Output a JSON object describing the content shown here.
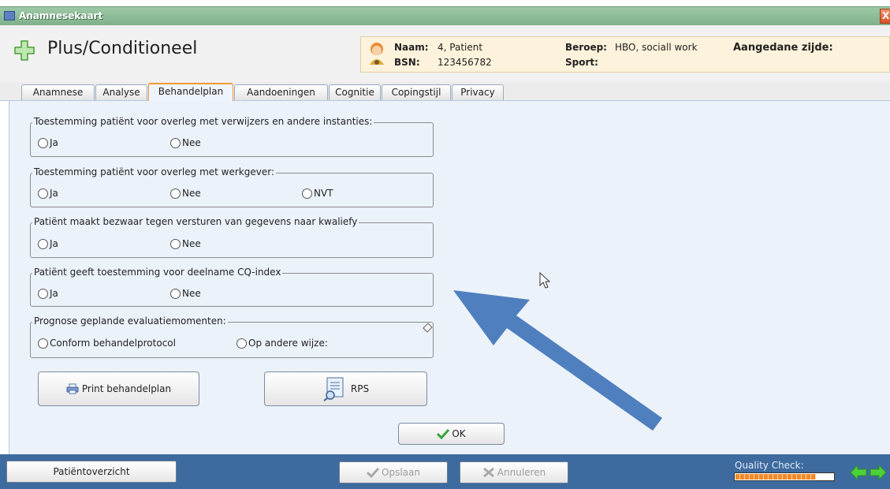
{
  "window": {
    "title": "Anamnesekaart",
    "close_glyph": "X"
  },
  "app": {
    "name": "Plus/Conditioneel",
    "icon": "plus-icon"
  },
  "patient": {
    "naam_label": "Naam:",
    "naam_value": "4, Patient",
    "bsn_label": "BSN:",
    "bsn_value": "123456782",
    "beroep_label": "Beroep:",
    "beroep_value": "HBO, sociall work",
    "sport_label": "Sport:",
    "zijde_label": "Aangedane zijde:"
  },
  "tabs": [
    {
      "label": "Anamnese",
      "active": false
    },
    {
      "label": "Analyse",
      "active": false
    },
    {
      "label": "Behandelplan",
      "active": true
    },
    {
      "label": "Aandoeningen",
      "active": false
    },
    {
      "label": "Cognitie",
      "active": false
    },
    {
      "label": "Copingstijl",
      "active": false
    },
    {
      "label": "Privacy",
      "active": false
    }
  ],
  "groups": {
    "overleg_verwijzers": {
      "legend": "Toestemming patiënt voor overleg met verwijzers en andere instanties:",
      "options": [
        "Ja",
        "Nee"
      ]
    },
    "overleg_werkgever": {
      "legend": "Toestemming patiënt voor overleg met werkgever:",
      "options": [
        "Ja",
        "Nee",
        "NVT"
      ]
    },
    "bezwaar": {
      "legend": "Patiënt maakt bezwaar tegen versturen van gegevens naar kwaliefy",
      "options": [
        "Ja",
        "Nee"
      ]
    },
    "cq_index": {
      "legend": "Patiënt geeft toestemming voor deelname CQ-index",
      "options": [
        "Ja",
        "Nee"
      ]
    },
    "prognose": {
      "legend": "Prognose geplande evaluatiemomenten:",
      "options": [
        "Conform behandelprotocol",
        "Op andere wijze:"
      ]
    }
  },
  "buttons": {
    "print": "Print behandelplan",
    "rps": "RPS",
    "ok": "OK"
  },
  "footer": {
    "overview": "Patiëntoverzicht",
    "save": "Opslaan",
    "cancel": "Annuleren",
    "quality_label": "Quality Check:",
    "quality_fraction": 0.82
  },
  "colors": {
    "accent_orange": "#f29b36",
    "footer_blue": "#3e6b9f",
    "annotation_arrow": "#4f7fbf",
    "ok_check": "#3aa23a",
    "nav_arrow": "#4cd23a"
  }
}
